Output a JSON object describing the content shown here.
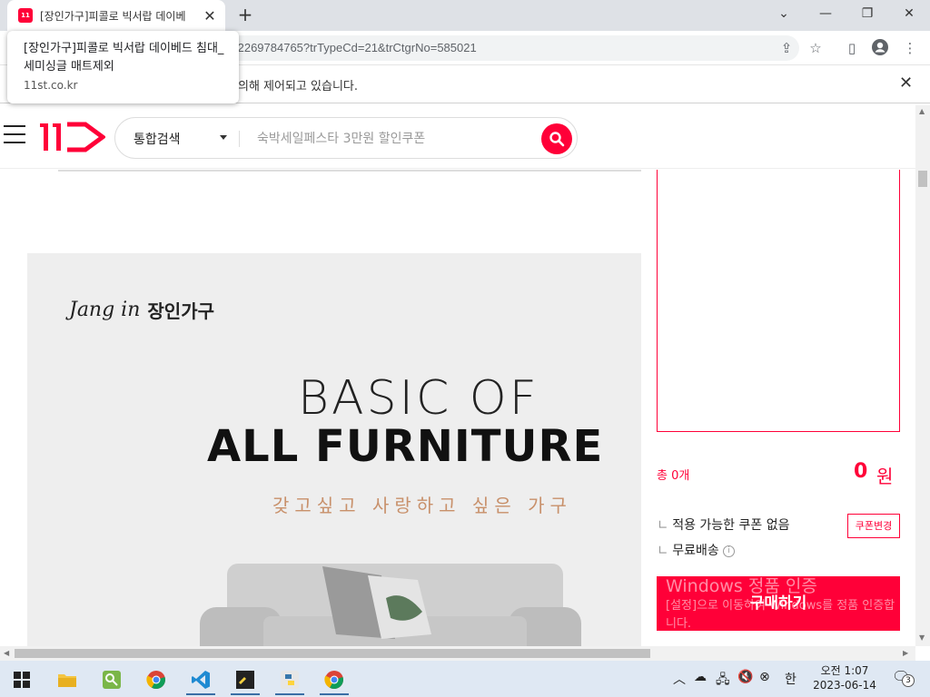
{
  "browser": {
    "tab_title": "[장인가구]피콜로 빅서랍 데이베",
    "url": "/2269784765?trTypeCd=21&trCtgrNo=585021",
    "infobar_text": "의해 제어되고 있습니다.",
    "tooltip": {
      "title": "[장인가구]피콜로 빅서랍 데이베드 침대_세미싱글 매트제외",
      "domain": "11st.co.kr"
    },
    "favicon_text": "11"
  },
  "header": {
    "search_category": "통합검색",
    "search_placeholder": "숙박세일페스타 3만원 할인쿠폰"
  },
  "banner": {
    "brand_script": "Jang in",
    "brand_korean": "장인가구",
    "headline_line1": "BASIC OF",
    "headline_line2": "ALL FURNITURE",
    "tagline": "갖고싶고 사랑하고 싶은 가구"
  },
  "order": {
    "total_label": "총 0개",
    "total_amount": "0",
    "total_unit": "원",
    "coupon_text": "적용 가능한 쿠폰 없음",
    "coupon_button": "쿠폰변경",
    "shipping_text": "무료배송",
    "buy_button": "구매하기"
  },
  "activation": {
    "title": "Windows 정품 인증",
    "body": "[설정]으로 이동하여 Windows를 정품 인증합니다."
  },
  "taskbar": {
    "ime": "한",
    "time": "오전 1:07",
    "date": "2023-06-14",
    "notification_count": "3"
  },
  "colors": {
    "brand_red": "#ff0038",
    "tagline": "#c8906a",
    "banner_bg": "#eeeeee"
  }
}
